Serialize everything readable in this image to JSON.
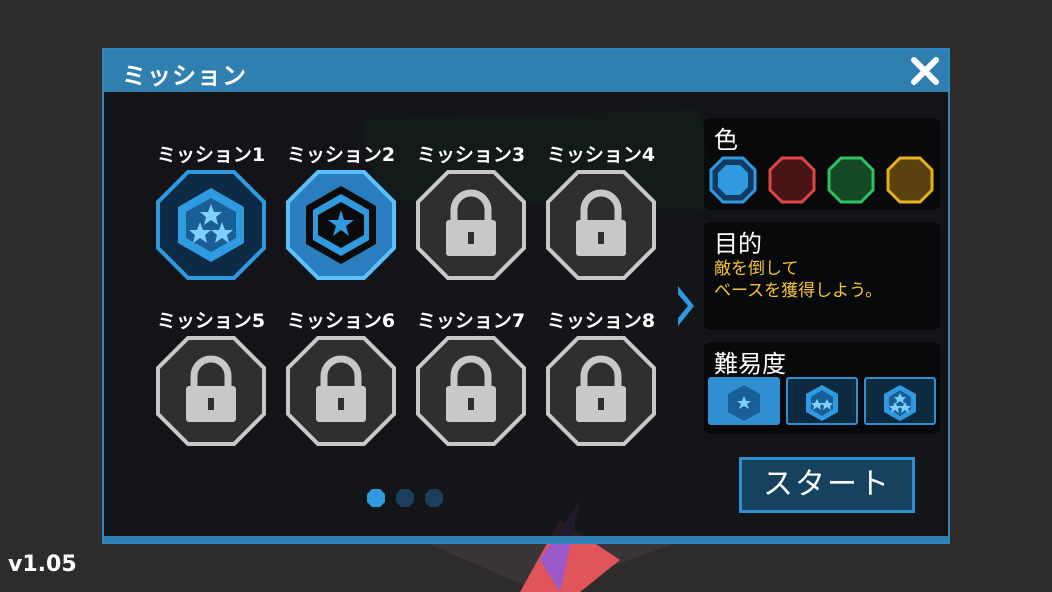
{
  "dialog": {
    "title": "ミッション",
    "close_icon": "close-icon"
  },
  "missions": [
    {
      "label": "ミッション1",
      "state": "cleared-3-stars",
      "icon": "three-star-badge-icon"
    },
    {
      "label": "ミッション2",
      "state": "selected",
      "icon": "star-badge-icon"
    },
    {
      "label": "ミッション3",
      "state": "locked",
      "icon": "lock-icon"
    },
    {
      "label": "ミッション4",
      "state": "locked",
      "icon": "lock-icon"
    },
    {
      "label": "ミッション5",
      "state": "locked",
      "icon": "lock-icon"
    },
    {
      "label": "ミッション6",
      "state": "locked",
      "icon": "lock-icon"
    },
    {
      "label": "ミッション7",
      "state": "locked",
      "icon": "lock-icon"
    },
    {
      "label": "ミッション8",
      "state": "locked",
      "icon": "lock-icon"
    }
  ],
  "pagination": {
    "pages": 3,
    "current": 1
  },
  "color_section": {
    "title": "色",
    "options": [
      {
        "name": "blue",
        "color": "#2f9ae0",
        "selected": true
      },
      {
        "name": "red",
        "color": "#e04545"
      },
      {
        "name": "green",
        "color": "#2fc060"
      },
      {
        "name": "yellow",
        "color": "#e8b020"
      }
    ]
  },
  "goal_section": {
    "title": "目的",
    "text": "敵を倒して\nベースを獲得しよう。"
  },
  "difficulty_section": {
    "title": "難易度",
    "options": [
      {
        "stars": 1,
        "selected": true
      },
      {
        "stars": 2
      },
      {
        "stars": 3
      }
    ]
  },
  "start_button": {
    "label": "スタート"
  },
  "version": "v1.05",
  "colors": {
    "accent": "#2f8fd0",
    "titlebar": "#2f7fb0",
    "goal_text": "#f3c23a"
  }
}
